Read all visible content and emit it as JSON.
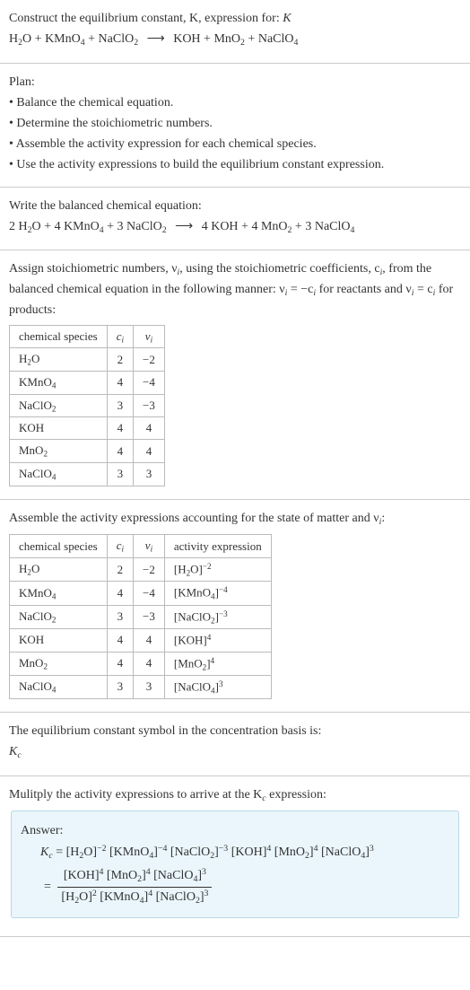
{
  "header": {
    "line1": "Construct the equilibrium constant, K, expression for:",
    "eq_lhs_h2o": "H",
    "eq_lhs_h2o_sub": "2",
    "eq_lhs_h2o_o": "O",
    "plus": " + ",
    "kmno4": "KMnO",
    "kmno4_sub": "4",
    "naclo2": "NaClO",
    "naclo2_sub": "2",
    "arrow": "⟶",
    "koh": "KOH",
    "mno2": "MnO",
    "mno2_sub": "2",
    "naclo4": "NaClO",
    "naclo4_sub": "4"
  },
  "plan": {
    "title": "Plan:",
    "b1": "• Balance the chemical equation.",
    "b2": "• Determine the stoichiometric numbers.",
    "b3": "• Assemble the activity expression for each chemical species.",
    "b4": "• Use the activity expressions to build the equilibrium constant expression."
  },
  "balanced": {
    "title": "Write the balanced chemical equation:",
    "c_h2o": "2 ",
    "c_kmno4": "4 ",
    "c_naclo2": "3 ",
    "c_koh": "4 ",
    "c_mno2": "4 ",
    "c_naclo4": "3 "
  },
  "assign": {
    "title_a": "Assign stoichiometric numbers, ν",
    "title_a_sub": "i",
    "title_b": ", using the stoichiometric coefficients, c",
    "title_b_sub": "i",
    "title_c": ", from the balanced chemical equation in the following manner: ν",
    "title_c_sub": "i",
    "title_d": " = −c",
    "title_d_sub": "i",
    "title_e": " for reactants and ν",
    "title_e_sub": "i",
    "title_f": " = c",
    "title_f_sub": "i",
    "title_g": " for products:"
  },
  "table1": {
    "h1": "chemical species",
    "h2_main": "c",
    "h2_sub": "i",
    "h3_main": "ν",
    "h3_sub": "i",
    "rows": [
      {
        "name_a": "H",
        "sub_a": "2",
        "name_b": "O",
        "c": "2",
        "v": "−2"
      },
      {
        "name_a": "KMnO",
        "sub_a": "4",
        "name_b": "",
        "c": "4",
        "v": "−4"
      },
      {
        "name_a": "NaClO",
        "sub_a": "2",
        "name_b": "",
        "c": "3",
        "v": "−3"
      },
      {
        "name_a": "KOH",
        "sub_a": "",
        "name_b": "",
        "c": "4",
        "v": "4"
      },
      {
        "name_a": "MnO",
        "sub_a": "2",
        "name_b": "",
        "c": "4",
        "v": "4"
      },
      {
        "name_a": "NaClO",
        "sub_a": "4",
        "name_b": "",
        "c": "3",
        "v": "3"
      }
    ]
  },
  "assemble": {
    "title_a": "Assemble the activity expressions accounting for the state of matter and ν",
    "title_sub": "i",
    "title_b": ":"
  },
  "table2": {
    "h1": "chemical species",
    "h2_main": "c",
    "h2_sub": "i",
    "h3_main": "ν",
    "h3_sub": "i",
    "h4": "activity expression",
    "rows": [
      {
        "name_a": "H",
        "sub_a": "2",
        "name_b": "O",
        "c": "2",
        "v": "−2",
        "act_a": "[H",
        "act_sub": "2",
        "act_b": "O]",
        "pow": "−2"
      },
      {
        "name_a": "KMnO",
        "sub_a": "4",
        "name_b": "",
        "c": "4",
        "v": "−4",
        "act_a": "[KMnO",
        "act_sub": "4",
        "act_b": "]",
        "pow": "−4"
      },
      {
        "name_a": "NaClO",
        "sub_a": "2",
        "name_b": "",
        "c": "3",
        "v": "−3",
        "act_a": "[NaClO",
        "act_sub": "2",
        "act_b": "]",
        "pow": "−3"
      },
      {
        "name_a": "KOH",
        "sub_a": "",
        "name_b": "",
        "c": "4",
        "v": "4",
        "act_a": "[KOH]",
        "act_sub": "",
        "act_b": "",
        "pow": "4"
      },
      {
        "name_a": "MnO",
        "sub_a": "2",
        "name_b": "",
        "c": "4",
        "v": "4",
        "act_a": "[MnO",
        "act_sub": "2",
        "act_b": "]",
        "pow": "4"
      },
      {
        "name_a": "NaClO",
        "sub_a": "4",
        "name_b": "",
        "c": "3",
        "v": "3",
        "act_a": "[NaClO",
        "act_sub": "4",
        "act_b": "]",
        "pow": "3"
      }
    ]
  },
  "kconst": {
    "line1": "The equilibrium constant symbol in the concentration basis is:",
    "kc_main": "K",
    "kc_sub": "c"
  },
  "multiply": {
    "title_a": "Mulitply the activity expressions to arrive at the K",
    "title_sub": "c",
    "title_b": " expression:"
  },
  "answer": {
    "label": "Answer:",
    "eq_prefix_k": "K",
    "eq_prefix_sub": "c",
    "eq_equals": " = ",
    "t1_a": "[H",
    "t1_sub": "2",
    "t1_b": "O]",
    "t1_pow": "−2",
    "t2_a": "[KMnO",
    "t2_sub": "4",
    "t2_b": "]",
    "t2_pow": "−4",
    "t3_a": "[NaClO",
    "t3_sub": "2",
    "t3_b": "]",
    "t3_pow": "−3",
    "t4_a": "[KOH]",
    "t4_pow": "4",
    "t5_a": "[MnO",
    "t5_sub": "2",
    "t5_b": "]",
    "t5_pow": "4",
    "t6_a": "[NaClO",
    "t6_sub": "4",
    "t6_b": "]",
    "t6_pow": "3",
    "frac_eq": "= ",
    "num_a": "[KOH]",
    "num_a_pow": "4",
    "num_b": "[MnO",
    "num_b_sub": "2",
    "num_b_b": "]",
    "num_b_pow": "4",
    "num_c": "[NaClO",
    "num_c_sub": "4",
    "num_c_b": "]",
    "num_c_pow": "3",
    "den_a": "[H",
    "den_a_sub": "2",
    "den_a_b": "O]",
    "den_a_pow": "2",
    "den_b": "[KMnO",
    "den_b_sub": "4",
    "den_b_b": "]",
    "den_b_pow": "4",
    "den_c": "[NaClO",
    "den_c_sub": "2",
    "den_c_b": "]",
    "den_c_pow": "3"
  }
}
